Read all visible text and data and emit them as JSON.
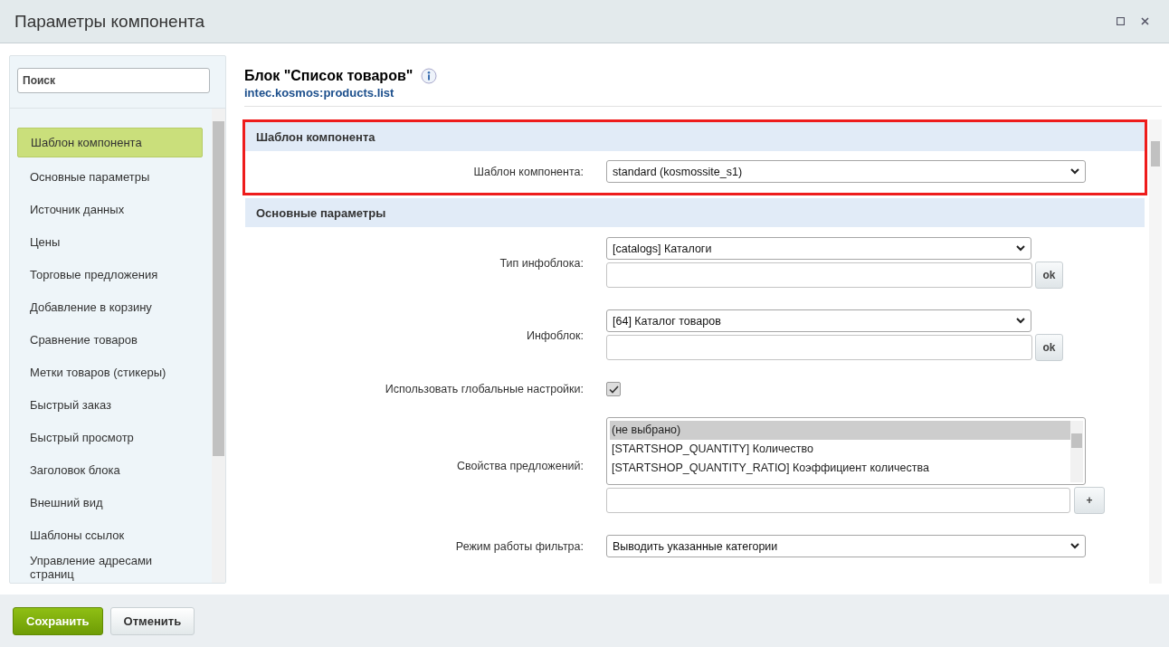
{
  "window": {
    "title": "Параметры компонента"
  },
  "sidebar": {
    "search": {
      "placeholder": "Поиск"
    },
    "items": [
      {
        "label": "Шаблон компонента",
        "selected": true
      },
      {
        "label": "Основные параметры",
        "selected": false
      },
      {
        "label": "Источник данных",
        "selected": false
      },
      {
        "label": "Цены",
        "selected": false
      },
      {
        "label": "Торговые предложения",
        "selected": false
      },
      {
        "label": "Добавление в корзину",
        "selected": false
      },
      {
        "label": "Сравнение товаров",
        "selected": false
      },
      {
        "label": "Метки товаров (стикеры)",
        "selected": false
      },
      {
        "label": "Быстрый заказ",
        "selected": false
      },
      {
        "label": "Быстрый просмотр",
        "selected": false
      },
      {
        "label": "Заголовок блока",
        "selected": false
      },
      {
        "label": "Внешний вид",
        "selected": false
      },
      {
        "label": "Шаблоны ссылок",
        "selected": false
      },
      {
        "label": "Управление адресами страниц",
        "selected": false
      }
    ]
  },
  "component": {
    "title": "Блок \"Список товаров\"",
    "code": "intec.kosmos:products.list"
  },
  "sections": [
    {
      "title": "Шаблон компонента",
      "highlighted": true,
      "fields": [
        {
          "kind": "select",
          "label": "Шаблон компонента:",
          "value": "standard (kosmossite_s1)"
        }
      ]
    },
    {
      "title": "Основные параметры",
      "highlighted": false,
      "fields": [
        {
          "kind": "select_text",
          "label": "Тип инфоблока:",
          "value": "[catalogs] Каталоги",
          "button": "ok"
        },
        {
          "kind": "select_text",
          "label": "Инфоблок:",
          "value": "[64] Каталог товаров",
          "button": "ok"
        },
        {
          "kind": "checkbox",
          "label": "Использовать глобальные настройки:",
          "checked": true
        },
        {
          "kind": "multiselect",
          "label": "Свойства предложений:",
          "button": "+",
          "options": [
            {
              "text": "(не выбрано)",
              "selected": true
            },
            {
              "text": "[STARTSHOP_QUANTITY] Количество",
              "selected": false
            },
            {
              "text": "[STARTSHOP_QUANTITY_RATIO] Коэффициент количества",
              "selected": false
            }
          ]
        },
        {
          "kind": "select",
          "label": "Режим работы фильтра:",
          "value": "Выводить указанные категории"
        }
      ]
    }
  ],
  "buttons": [
    {
      "label": "Сохранить",
      "kind": "primary"
    },
    {
      "label": "Отменить",
      "kind": "secondary"
    }
  ]
}
